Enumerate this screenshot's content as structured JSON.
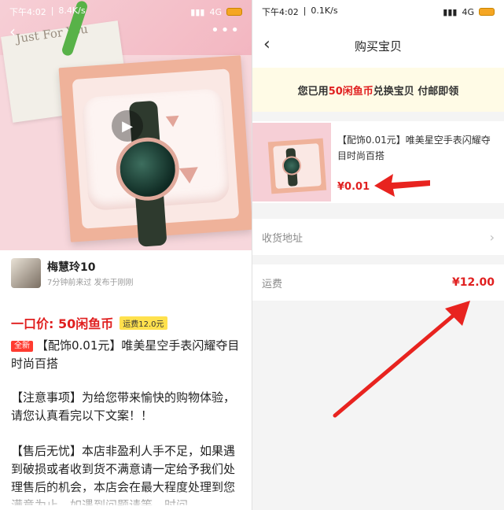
{
  "left": {
    "status": {
      "time": "下午4:02",
      "speed": "8.4K/s",
      "network": "4G"
    },
    "hero": {
      "card_text": "Just For You"
    },
    "seller": {
      "name": "梅慧玲10",
      "meta": "7分钟前来过 发布于刚刚"
    },
    "price": {
      "label": "一口价: 50闲鱼币",
      "shipping_badge": "运费12.0元"
    },
    "title": {
      "tag": "全新",
      "text": "【配饰0.01元】唯美星空手表闪耀夺目时尚百搭"
    },
    "paragraphs": [
      "【注意事项】为给您带来愉快的购物体验，请您认真看完以下文案！！",
      "【售后无忧】本店非盈利人手不足，如果遇到破损或者收到货不满意请一定给予我们处理售后的机会，本店会在最大程度处理到您满意为止，如遇到问题请等，时间"
    ]
  },
  "right": {
    "status": {
      "time": "下午4:02",
      "speed": "0.1K/s",
      "network": "4G"
    },
    "nav": {
      "title": "购买宝贝"
    },
    "notice": {
      "prefix": "您已用",
      "highlight": "50闲鱼币",
      "suffix": "兑换宝贝 付邮即领"
    },
    "item": {
      "desc": "【配饰0.01元】唯美星空手表闪耀夺目时尚百搭",
      "price": "¥0.01"
    },
    "address_label": "收货地址",
    "fee": {
      "label": "运费",
      "value": "¥12.00"
    }
  },
  "annotation_color": "#e8231f",
  "icons": [
    "back-arrow-icon",
    "more-dots-icon",
    "play-icon",
    "chevron-right-icon",
    "signal-icon",
    "wifi-icon",
    "battery-icon"
  ]
}
